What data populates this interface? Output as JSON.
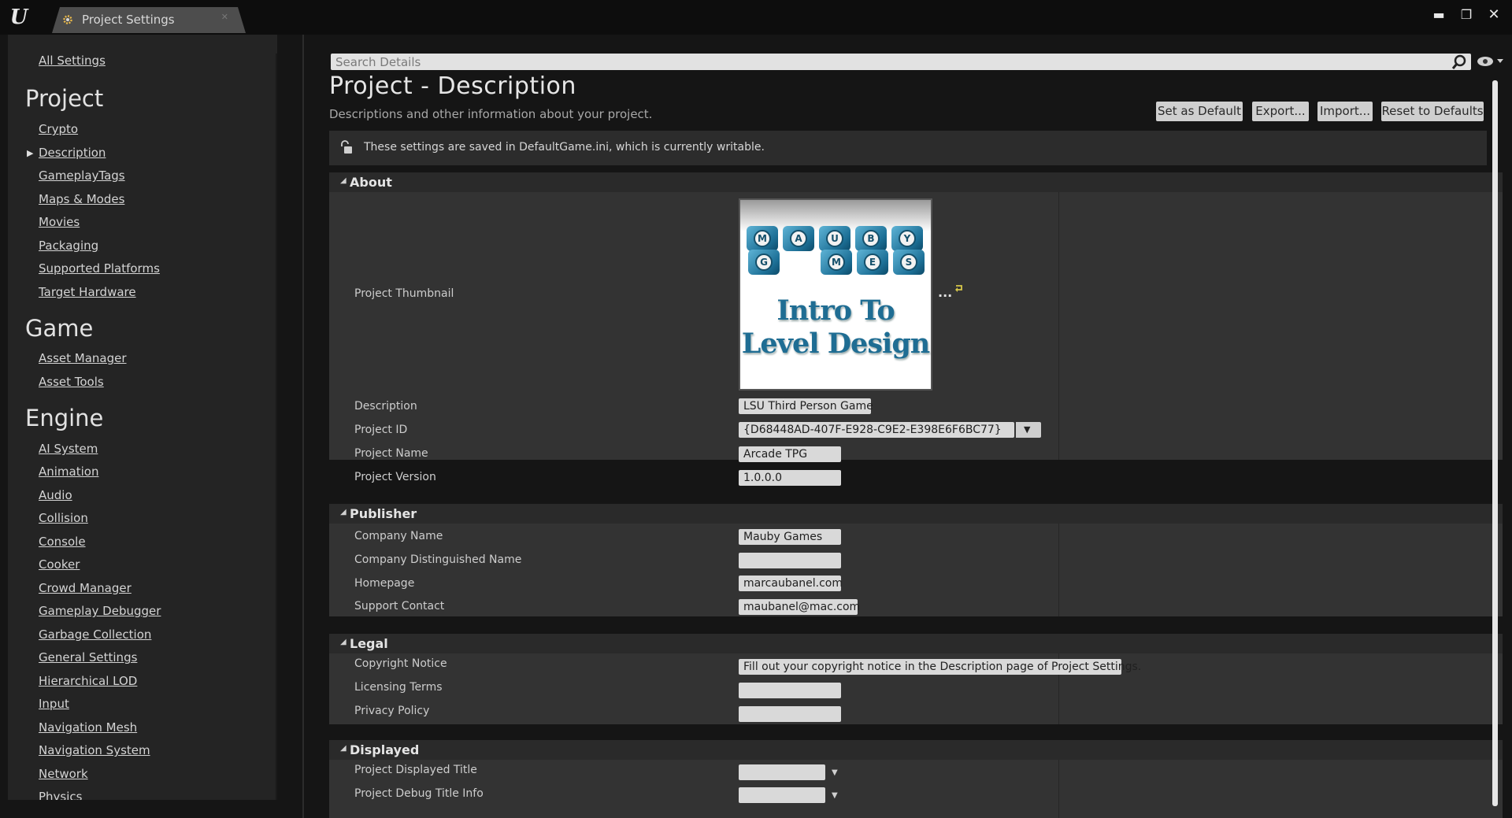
{
  "window": {
    "tab_title": "Project Settings",
    "logo_text": "U"
  },
  "sidebar": {
    "all_settings": "All Settings",
    "sections": [
      {
        "heading": "Project",
        "items": [
          "Crypto",
          "Description",
          "GameplayTags",
          "Maps & Modes",
          "Movies",
          "Packaging",
          "Supported Platforms",
          "Target Hardware"
        ]
      },
      {
        "heading": "Game",
        "items": [
          "Asset Manager",
          "Asset Tools"
        ]
      },
      {
        "heading": "Engine",
        "items": [
          "AI System",
          "Animation",
          "Audio",
          "Collision",
          "Console",
          "Cooker",
          "Crowd Manager",
          "Gameplay Debugger",
          "Garbage Collection",
          "General Settings",
          "Hierarchical LOD",
          "Input",
          "Navigation Mesh",
          "Navigation System",
          "Network",
          "Physics"
        ]
      }
    ],
    "selected_item": "Description"
  },
  "search": {
    "placeholder": "Search Details"
  },
  "header": {
    "title": "Project - Description",
    "subtitle": "Descriptions and other information about your project.",
    "buttons": {
      "set_default": "Set as Default",
      "export": "Export...",
      "import": "Import...",
      "reset": "Reset to Defaults"
    }
  },
  "notice": {
    "text": "These settings are saved in DefaultGame.ini, which is currently writable."
  },
  "about": {
    "label": "About",
    "thumbnail_label": "Project Thumbnail",
    "thumbnail": {
      "dice_top": [
        "M",
        "A",
        "U",
        "B",
        "Y"
      ],
      "dice_bottom": [
        "G",
        "M",
        "E",
        "S"
      ],
      "line1": "Intro To",
      "line2": "Level Design"
    },
    "description_label": "Description",
    "description_value": "LSU Third Person Game",
    "project_id_label": "Project ID",
    "project_id_value": "{D68448AD-407F-E928-C9E2-E398E6F6BC77}",
    "project_name_label": "Project Name",
    "project_name_value": "Arcade TPG",
    "project_version_label": "Project Version",
    "project_version_value": "1.0.0.0"
  },
  "publisher": {
    "label": "Publisher",
    "company_name_label": "Company Name",
    "company_name_value": "Mauby Games",
    "company_dn_label": "Company Distinguished Name",
    "company_dn_value": "",
    "homepage_label": "Homepage",
    "homepage_value": "marcaubanel.com",
    "support_label": "Support Contact",
    "support_value": "maubanel@mac.com"
  },
  "legal": {
    "label": "Legal",
    "copyright_label": "Copyright Notice",
    "copyright_value": "Fill out your copyright notice in the Description page of Project Settings.",
    "licensing_label": "Licensing Terms",
    "licensing_value": "",
    "privacy_label": "Privacy Policy",
    "privacy_value": ""
  },
  "displayed": {
    "label": "Displayed",
    "title_label": "Project Displayed Title",
    "title_value": "",
    "debug_label": "Project Debug Title Info",
    "debug_value": ""
  }
}
